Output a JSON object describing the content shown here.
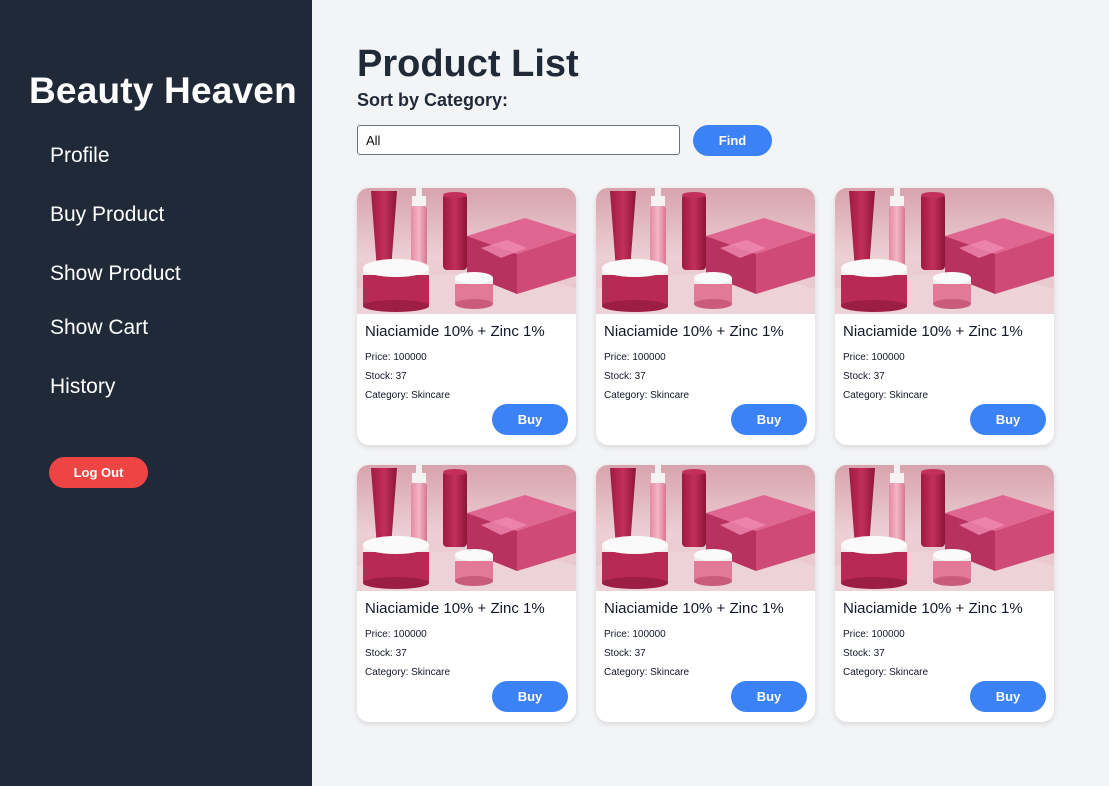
{
  "sidebar": {
    "brand": "Beauty Heaven",
    "nav": [
      "Profile",
      "Buy Product",
      "Show Product",
      "Show Cart",
      "History"
    ],
    "logout_label": "Log Out"
  },
  "main": {
    "title": "Product List",
    "sort_label": "Sort by Category:",
    "category_value": "All",
    "find_label": "Find"
  },
  "products": [
    {
      "name": "Niaciamide 10% + Zinc 1%",
      "price": "Price: 100000",
      "stock": "Stock: 37",
      "category": "Category: Skincare",
      "buy_label": "Buy",
      "image_icon": "cosmetics-product-image"
    },
    {
      "name": "Niaciamide 10% + Zinc 1%",
      "price": "Price: 100000",
      "stock": "Stock: 37",
      "category": "Category: Skincare",
      "buy_label": "Buy",
      "image_icon": "cosmetics-product-image"
    },
    {
      "name": "Niaciamide 10% + Zinc 1%",
      "price": "Price: 100000",
      "stock": "Stock: 37",
      "category": "Category: Skincare",
      "buy_label": "Buy",
      "image_icon": "cosmetics-product-image"
    },
    {
      "name": "Niaciamide 10% + Zinc 1%",
      "price": "Price: 100000",
      "stock": "Stock: 37",
      "category": "Category: Skincare",
      "buy_label": "Buy",
      "image_icon": "cosmetics-product-image"
    },
    {
      "name": "Niaciamide 10% + Zinc 1%",
      "price": "Price: 100000",
      "stock": "Stock: 37",
      "category": "Category: Skincare",
      "buy_label": "Buy",
      "image_icon": "cosmetics-product-image"
    },
    {
      "name": "Niaciamide 10% + Zinc 1%",
      "price": "Price: 100000",
      "stock": "Stock: 37",
      "category": "Category: Skincare",
      "buy_label": "Buy",
      "image_icon": "cosmetics-product-image"
    }
  ],
  "colors": {
    "sidebar_bg": "#1f2937",
    "page_bg": "#f3f4f6",
    "accent_blue": "#3b82f6",
    "logout_red": "#ef4444"
  }
}
